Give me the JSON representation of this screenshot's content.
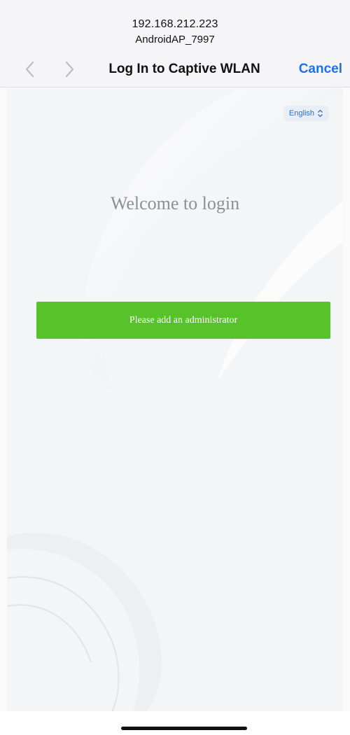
{
  "header": {
    "ip": "192.168.212.223",
    "ssid": "AndroidAP_7997",
    "title": "Log In to Captive WLAN",
    "cancel_label": "Cancel"
  },
  "language": {
    "selected": "English",
    "icon": "up-down-chevron-icon"
  },
  "main": {
    "welcome": "Welcome to login",
    "admin_button_label": "Please add an administrator"
  },
  "colors": {
    "accent_blue": "#1a73e8",
    "button_green": "#58c22b",
    "welcome_text": "#8a9096"
  }
}
